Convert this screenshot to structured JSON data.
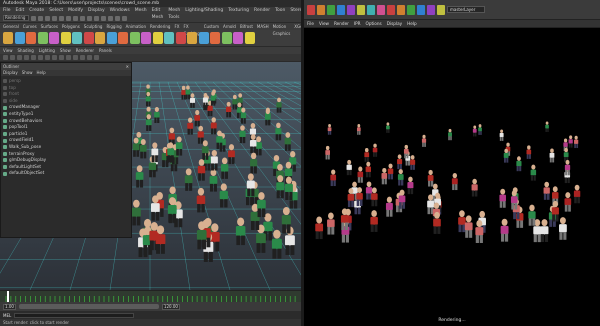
{
  "maya": {
    "title": "Autodesk Maya 2018: C:\\Users\\user\\projects\\scenes\\crowd_scene.mb",
    "menubar": [
      "File",
      "Edit",
      "Create",
      "Select",
      "Modify",
      "Display",
      "Windows",
      "Mesh",
      "Edit Mesh",
      "Mesh Tools",
      "Lighting/Shading",
      "Texturing",
      "Render",
      "Toon",
      "Stereo",
      "Paint Effects",
      "Bonus Tools",
      "Arnold",
      "Golaem",
      "Help"
    ],
    "menuset": "Rendering",
    "shelf_tabs": [
      "General",
      "Curves",
      "Surfaces",
      "Polygons",
      "Sculpting",
      "Rigging",
      "Animation",
      "Rendering",
      "FX",
      "FX Caching",
      "Custom",
      "Arnold",
      "Bifrost",
      "MASH",
      "Motion Graphics",
      "XGen",
      "Golaem"
    ],
    "panel_menu": [
      "View",
      "Shading",
      "Lighting",
      "Show",
      "Renderer",
      "Panels"
    ],
    "outliner": {
      "title": "Outliner",
      "menu": [
        "Display",
        "Show",
        "Help"
      ],
      "items": [
        {
          "label": "persp",
          "dim": true
        },
        {
          "label": "top",
          "dim": true
        },
        {
          "label": "front",
          "dim": true
        },
        {
          "label": "side",
          "dim": true
        },
        {
          "label": "crowdManager",
          "dim": false
        },
        {
          "label": "entityType1",
          "dim": false
        },
        {
          "label": "crowdBehaviors",
          "dim": false
        },
        {
          "label": "popTool1",
          "dim": false
        },
        {
          "label": "particle1",
          "dim": false
        },
        {
          "label": "crowdField1",
          "dim": false
        },
        {
          "label": "Walk_Sub_pose",
          "dim": false
        },
        {
          "label": "terrainProxy",
          "dim": false
        },
        {
          "label": "glmDebugDisplay",
          "dim": false
        },
        {
          "label": "defaultLightSet",
          "dim": false
        },
        {
          "label": "defaultObjectSet",
          "dim": false
        }
      ]
    },
    "range": {
      "start": "1.00",
      "end": "120.00"
    },
    "cmd_label": "MEL",
    "help_line": "Start render: click to start render"
  },
  "render_view": {
    "layer_dropdown": "masterLayer",
    "menu": [
      "File",
      "View",
      "Render",
      "IPR",
      "Options",
      "Display",
      "Help"
    ],
    "status": "Rendering..."
  },
  "colors": {
    "viewport_grid": "#46d0d0",
    "timeline_green": "#3fcc3f",
    "shirt_red": "#b22a22",
    "shirt_white": "#e6e6e6",
    "shirt_green": "#2a8a4a",
    "shirt_magenta": "#b53a8a",
    "pants_dark": "#202020",
    "pants_grey": "#777777"
  }
}
